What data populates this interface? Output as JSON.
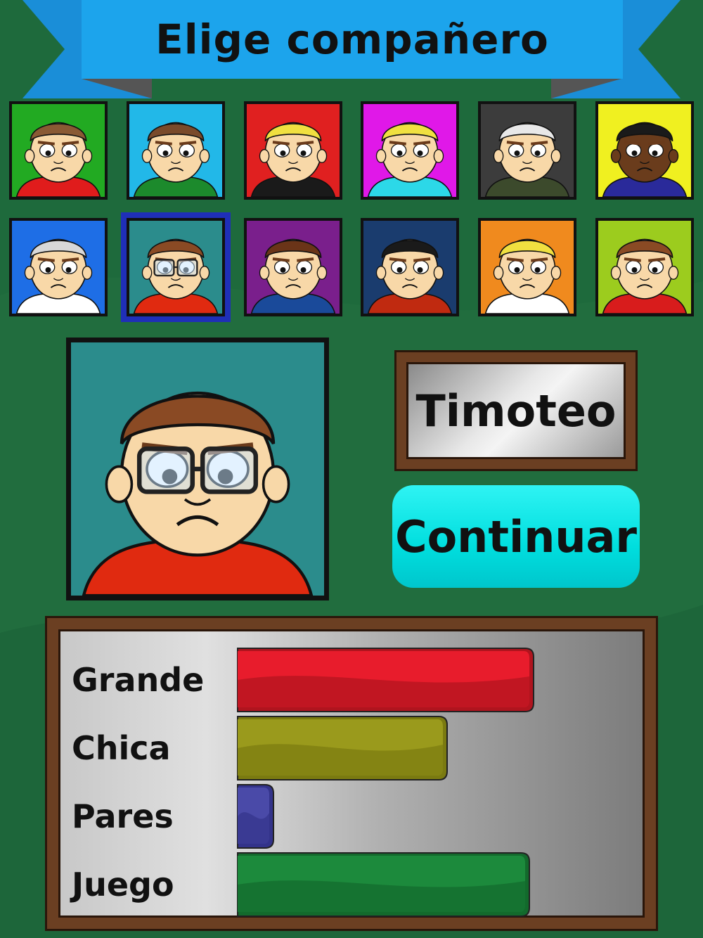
{
  "header": {
    "title": "Elige compañero"
  },
  "characters": [
    {
      "icon": "portrait-man-brown-hair-icon",
      "bg": "#22aa22"
    },
    {
      "icon": "portrait-man-smiling-icon",
      "bg": "#22b8e8"
    },
    {
      "icon": "portrait-blond-man-goatee-icon",
      "bg": "#e02020"
    },
    {
      "icon": "portrait-blonde-woman-icon",
      "bg": "#e018e8"
    },
    {
      "icon": "portrait-old-man-mustache-icon",
      "bg": "#3c3c3c"
    },
    {
      "icon": "portrait-dark-skinned-man-icon",
      "bg": "#f0f020"
    },
    {
      "icon": "portrait-bald-man-bowtie-icon",
      "bg": "#1e6ee6"
    },
    {
      "icon": "portrait-man-glasses-icon",
      "bg": "#2b8c8c",
      "selected": true
    },
    {
      "icon": "portrait-brunette-woman-icon",
      "bg": "#7a1f8c"
    },
    {
      "icon": "portrait-spiky-black-hair-man-icon",
      "bg": "#1a3c6e"
    },
    {
      "icon": "portrait-blond-man-red-tie-icon",
      "bg": "#f08a1e"
    },
    {
      "icon": "portrait-king-crown-icon",
      "bg": "#9ccc1e"
    }
  ],
  "selected": {
    "name": "Timoteo",
    "icon": "portrait-man-glasses-large-icon"
  },
  "continue_button": {
    "label": "Continuar"
  },
  "stats": [
    {
      "label": "Grande",
      "value": 0.75,
      "color": "#e81c2c",
      "dark": "#b0141e"
    },
    {
      "label": "Chica",
      "value": 0.53,
      "color": "#9a9a1c",
      "dark": "#7a7a10"
    },
    {
      "label": "Pares",
      "value": 0.09,
      "color": "#4a4aa8",
      "dark": "#33338a"
    },
    {
      "label": "Juego",
      "value": 0.74,
      "color": "#1c8a3c",
      "dark": "#136a2c"
    }
  ]
}
